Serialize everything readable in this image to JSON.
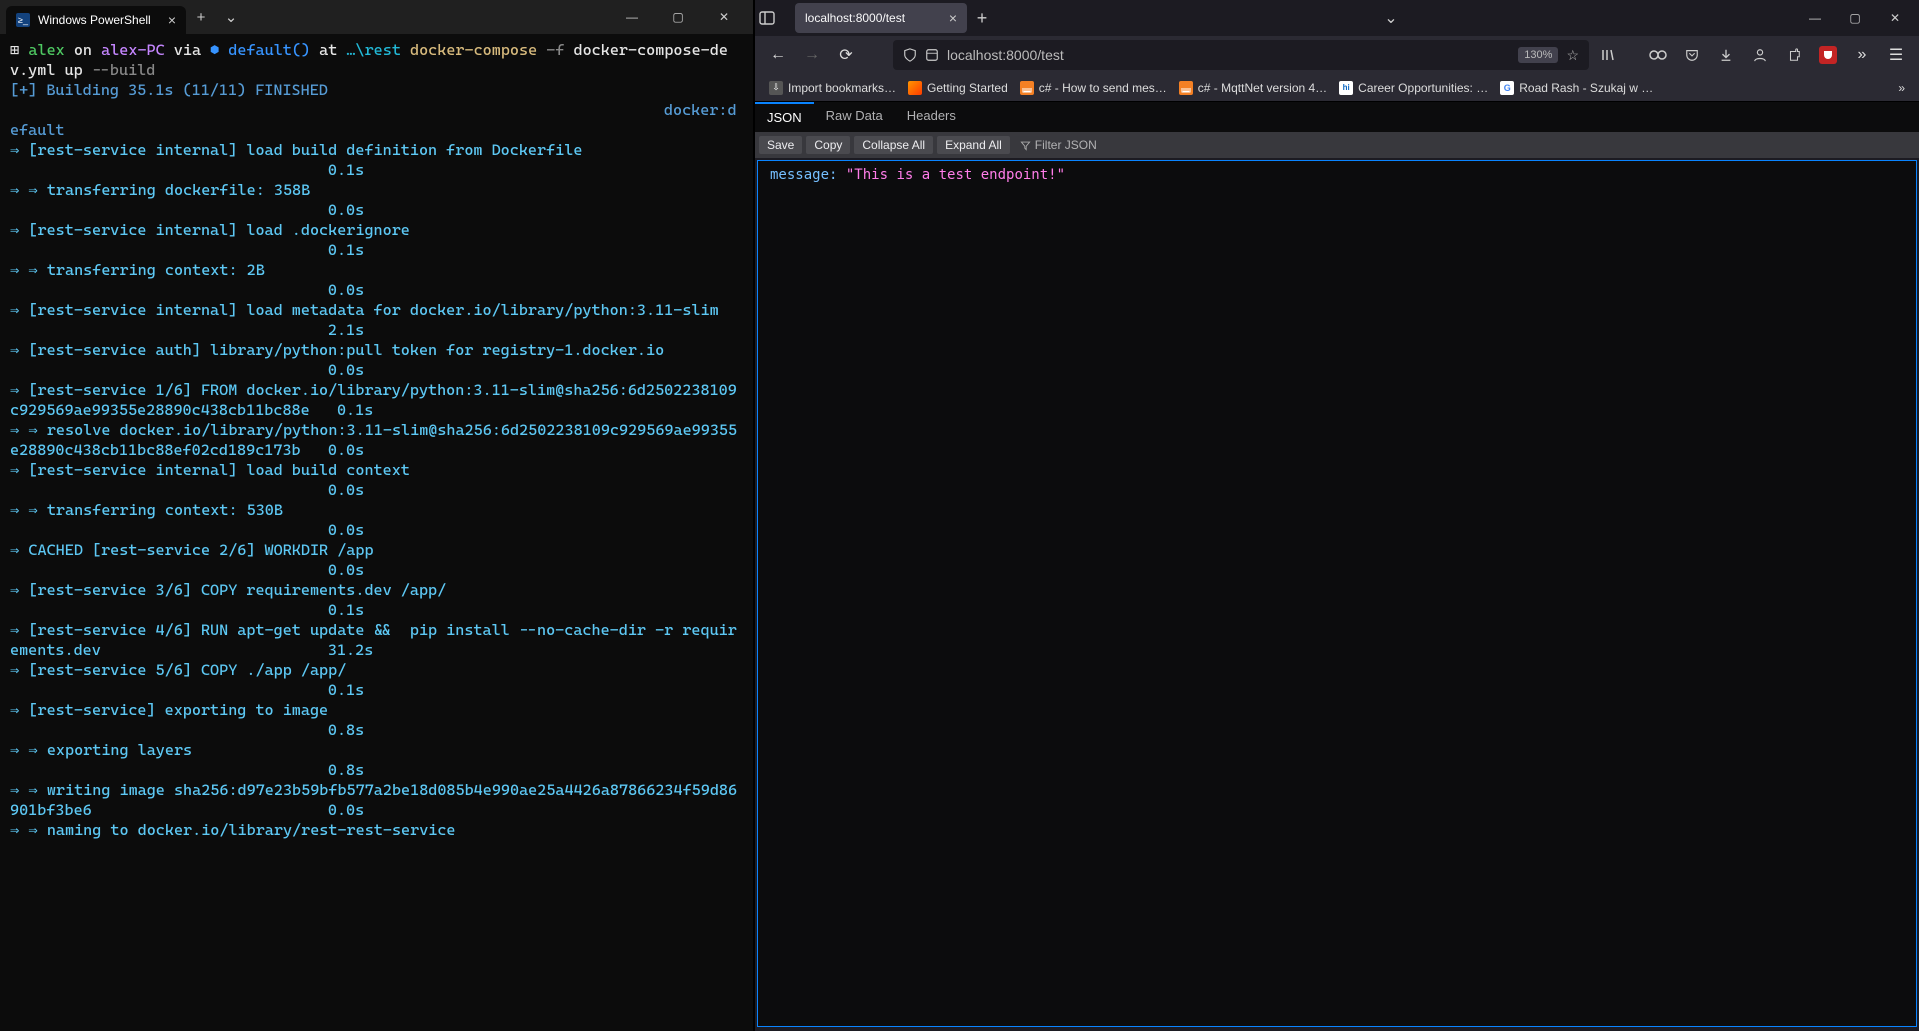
{
  "terminal": {
    "tab_title": "Windows PowerShell",
    "prompt": {
      "user": "alex",
      "on": "on",
      "host": "alex-PC",
      "via": "via",
      "env": "default()",
      "at": "at",
      "path": "…\\rest",
      "cmd": "docker-compose",
      "flag": "-f",
      "arg": "docker-compose-dev.yml up",
      "cmd2": "--build"
    },
    "build_header": "[+] Building 35.1s (11/11) FINISHED",
    "docker_def": "docker:default",
    "lines": [
      "⇒ [rest-service internal] load build definition from Dockerfile",
      "                                   0.1s",
      "⇒ ⇒ transferring dockerfile: 358B",
      "                                   0.0s",
      "⇒ [rest-service internal] load .dockerignore",
      "                                   0.1s",
      "⇒ ⇒ transferring context: 2B",
      "                                   0.0s",
      "⇒ [rest-service internal] load metadata for docker.io/library/python:3.11-slim",
      "                                   2.1s",
      "⇒ [rest-service auth] library/python:pull token for registry-1.docker.io",
      "                                   0.0s",
      "⇒ [rest-service 1/6] FROM docker.io/library/python:3.11-slim@sha256:6d2502238109c929569ae99355e28890c438cb11bc88e   0.1s",
      "⇒ ⇒ resolve docker.io/library/python:3.11-slim@sha256:6d2502238109c929569ae99355e28890c438cb11bc88ef02cd189c173b   0.0s",
      "⇒ [rest-service internal] load build context",
      "                                   0.0s",
      "⇒ ⇒ transferring context: 530B",
      "                                   0.0s",
      "⇒ CACHED [rest-service 2/6] WORKDIR /app",
      "                                   0.0s",
      "⇒ [rest-service 3/6] COPY requirements.dev /app/",
      "                                   0.1s",
      "⇒ [rest-service 4/6] RUN apt-get update &&  pip install --no-cache-dir -r requirements.dev                         31.2s",
      "⇒ [rest-service 5/6] COPY ./app /app/",
      "                                   0.1s",
      "⇒ [rest-service] exporting to image",
      "                                   0.8s",
      "⇒ ⇒ exporting layers",
      "                                   0.8s",
      "⇒ ⇒ writing image sha256:d97e23b59bfb577a2be18d085b4e990ae25a4426a87866234f59d86901bf3be6                          0.0s",
      "⇒ ⇒ naming to docker.io/library/rest-rest-service"
    ]
  },
  "browser": {
    "tab_title": "localhost:8000/test",
    "url": "localhost:8000/test",
    "zoom": "130%",
    "bookmarks": [
      {
        "label": "Import bookmarks…",
        "icon": "↓"
      },
      {
        "label": "Getting Started",
        "icon": "ff"
      },
      {
        "label": "c# - How to send mes…",
        "icon": "so"
      },
      {
        "label": "c# - MqttNet version 4…",
        "icon": "so"
      },
      {
        "label": "Career Opportunities: …",
        "icon": "hi"
      },
      {
        "label": "Road Rash - Szukaj w …",
        "icon": "G"
      }
    ],
    "json_tabs": [
      "JSON",
      "Raw Data",
      "Headers"
    ],
    "json_toolbar": [
      "Save",
      "Copy",
      "Collapse All",
      "Expand All"
    ],
    "filter_placeholder": "Filter JSON",
    "json_key": "message:",
    "json_value": "\"This is a test endpoint!\""
  }
}
